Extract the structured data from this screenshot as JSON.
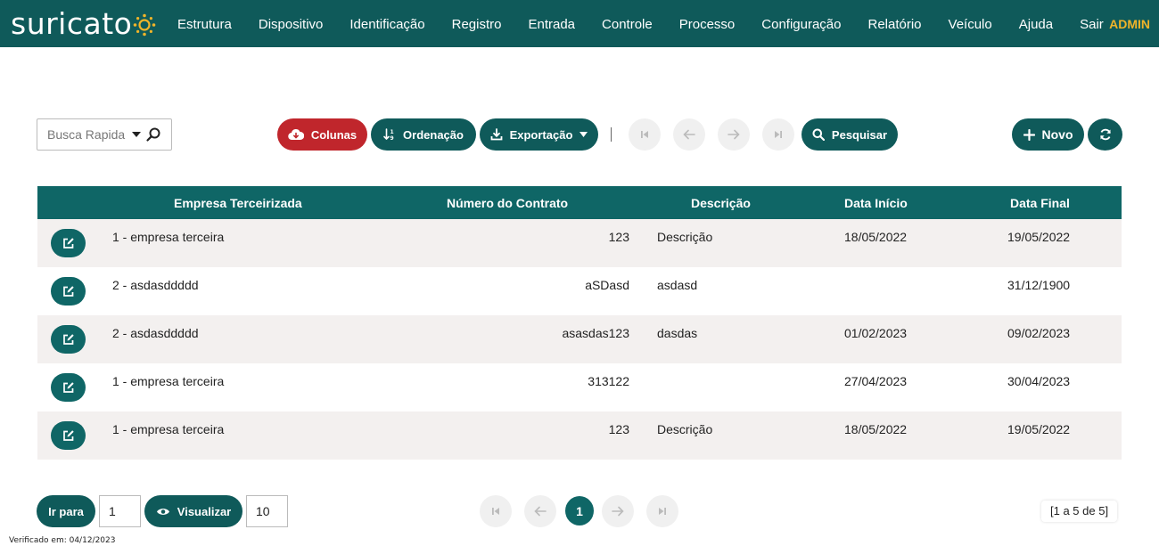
{
  "app": {
    "logo_text": "suricato"
  },
  "nav": {
    "items": [
      "Estrutura",
      "Dispositivo",
      "Identificação",
      "Registro",
      "Entrada",
      "Controle",
      "Processo",
      "Configuração",
      "Relatório",
      "Veículo",
      "Ajuda",
      "Sair"
    ],
    "user": "ADMIN"
  },
  "toolbar": {
    "quick_search_label": "Busca Rapida",
    "colunas_label": "Colunas",
    "ordenacao_label": "Ordenação",
    "exportacao_label": "Exportação",
    "pesquisar_label": "Pesquisar",
    "novo_label": "Novo"
  },
  "table": {
    "columns": [
      "Empresa Terceirizada",
      "Número do Contrato",
      "Descrição",
      "Data Início",
      "Data Final"
    ],
    "rows": [
      {
        "empresa": "1 - empresa terceira",
        "contrato": "123",
        "descricao": "Descrição",
        "inicio": "18/05/2022",
        "final": "19/05/2022"
      },
      {
        "empresa": "2 - asdasddddd",
        "contrato": "aSDasd",
        "descricao": "asdasd",
        "inicio": "",
        "final": "31/12/1900"
      },
      {
        "empresa": "2 - asdasddddd",
        "contrato": "asasdas123",
        "descricao": "dasdas",
        "inicio": "01/02/2023",
        "final": "09/02/2023"
      },
      {
        "empresa": "1 - empresa terceira",
        "contrato": "313122",
        "descricao": "",
        "inicio": "27/04/2023",
        "final": "30/04/2023"
      },
      {
        "empresa": "1 - empresa terceira",
        "contrato": "123",
        "descricao": "Descrição",
        "inicio": "18/05/2022",
        "final": "19/05/2022"
      }
    ]
  },
  "footer": {
    "irpara_label": "Ir para",
    "page_value": "1",
    "visualizar_label": "Visualizar",
    "page_size_value": "10",
    "current_page": "1",
    "range_text": "[1 a 5 de 5]",
    "verified_text": "Verificado em: 04/12/2023"
  },
  "colors": {
    "primary": "#0f5a5a",
    "header": "#0f6666",
    "danger": "#c0262c",
    "accent": "#f0b429"
  },
  "icons": {
    "logo": "sun-dots-icon",
    "quick_search": "magnifier-icon",
    "colunas": "cloud-icon",
    "ordenacao": "sort-icon",
    "exportacao": "download-icon",
    "first": "first-page-icon",
    "prev": "arrow-left-icon",
    "next": "arrow-right-icon",
    "last": "last-page-icon",
    "pesquisar": "search-icon",
    "novo": "plus-icon",
    "refresh": "refresh-icon",
    "edit": "edit-icon",
    "visualizar": "eye-icon"
  }
}
